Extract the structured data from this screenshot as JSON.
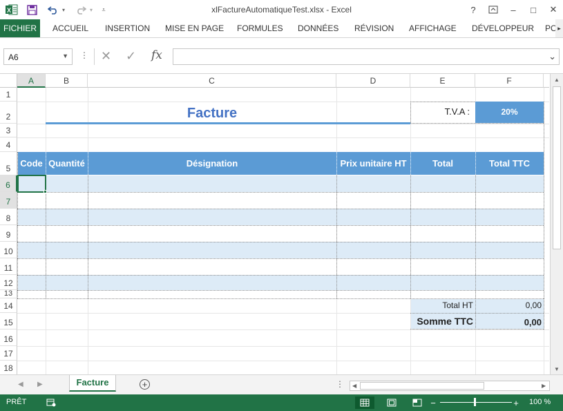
{
  "title_bar": {
    "title": "xlFactureAutomatiqueTest.xlsx - Excel",
    "help": "?",
    "minimize": "–",
    "restore": "□",
    "close": "✕"
  },
  "ribbon": {
    "file_tab": "FICHIER",
    "tabs": [
      "ACCUEIL",
      "INSERTION",
      "MISE EN PAGE",
      "FORMULES",
      "DONNÉES",
      "RÉVISION",
      "AFFICHAGE",
      "DÉVELOPPEUR",
      "PO"
    ]
  },
  "formula_bar": {
    "name_box": "A6",
    "formula": "",
    "fx": "fx"
  },
  "grid": {
    "columns": [
      "A",
      "B",
      "C",
      "D",
      "E",
      "F"
    ],
    "rows": [
      "1",
      "2",
      "3",
      "4",
      "5",
      "6",
      "7",
      "8",
      "9",
      "10",
      "11",
      "12",
      "13",
      "14",
      "15",
      "16",
      "17",
      "18"
    ],
    "selected_cell": "A6"
  },
  "invoice": {
    "title": "Facture",
    "tva_label": "T.V.A :",
    "tva_value": "20%",
    "headers": [
      "Code",
      "Quantité",
      "Désignation",
      "Prix unitaire HT",
      "Total",
      "Total TTC"
    ],
    "total_ht_label": "Total HT",
    "total_ht_value": "0,00",
    "somme_ttc_label": "Somme TTC",
    "somme_ttc_value": "0,00"
  },
  "sheets": {
    "active": "Facture",
    "add": "+"
  },
  "status_bar": {
    "ready": "PRÊT",
    "zoom_level": "100 %"
  },
  "colors": {
    "excel_green": "#217346",
    "header_blue": "#5b9bd5",
    "band_blue": "#ddebf7",
    "title_blue": "#4472c4"
  }
}
